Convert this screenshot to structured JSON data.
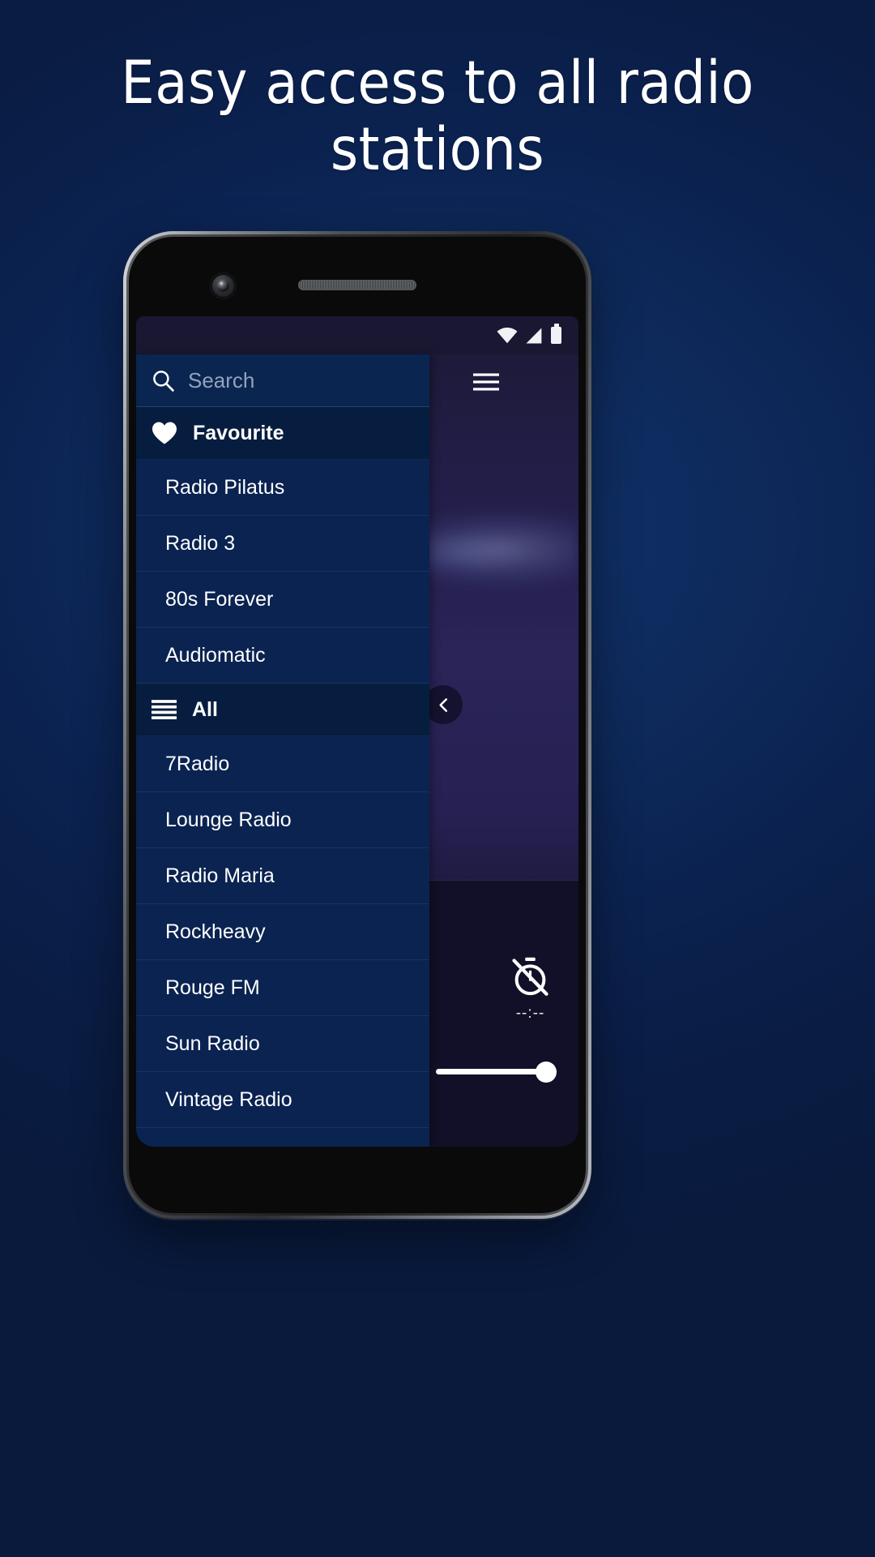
{
  "headline": "Easy access to all radio stations",
  "statusbar": {
    "wifi_icon": "wifi-icon",
    "signal_icon": "cellular-signal-icon",
    "battery_icon": "battery-icon"
  },
  "drawer": {
    "search": {
      "icon": "search-icon",
      "placeholder": "Search",
      "value": ""
    },
    "menu_icon": "hamburger-menu-icon",
    "sections": [
      {
        "id": "favourite",
        "icon": "heart-icon",
        "title": "Favourite",
        "items": [
          "Radio Pilatus",
          "Radio 3",
          "80s Forever",
          "Audiomatic"
        ]
      },
      {
        "id": "all",
        "icon": "list-lines-icon",
        "title": "All",
        "items": [
          "7Radio",
          "Lounge Radio",
          "Radio Maria",
          "Rockheavy",
          "Rouge FM",
          "Sun Radio",
          "Vintage Radio"
        ]
      }
    ]
  },
  "player": {
    "collapse_icon": "chevron-left-icon",
    "sleep_timer": {
      "icon": "timer-off-icon",
      "label": "--:--"
    },
    "volume": {
      "value": 100
    }
  },
  "colors": {
    "page_background": "#0b2250",
    "drawer_background": "#0a2351",
    "section_header_background": "#061d3f",
    "status_bar_background": "#1a1733",
    "accent_white": "#ffffff",
    "placeholder_text": "#93a3bb"
  }
}
